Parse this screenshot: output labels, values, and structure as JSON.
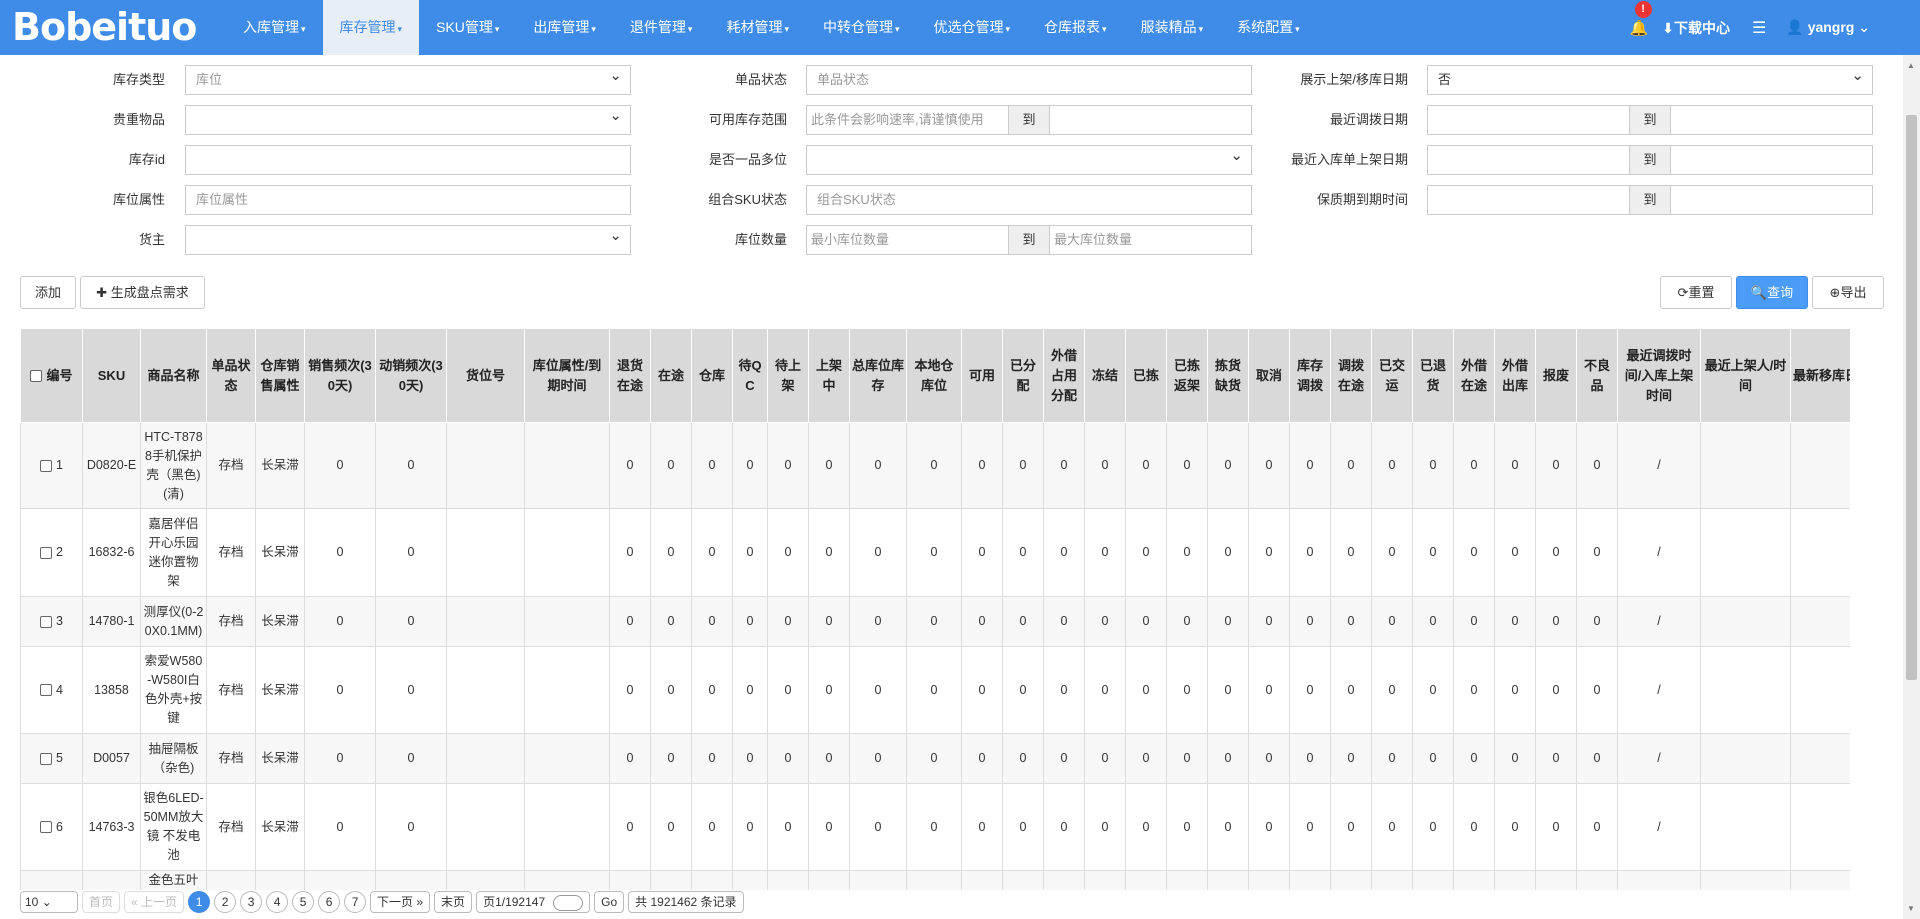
{
  "app": {
    "logo": "Bobeituo"
  },
  "nav": [
    {
      "label": "入库管理",
      "active": false
    },
    {
      "label": "库存管理",
      "active": true
    },
    {
      "label": "SKU管理",
      "active": false
    },
    {
      "label": "出库管理",
      "active": false
    },
    {
      "label": "退件管理",
      "active": false
    },
    {
      "label": "耗材管理",
      "active": false
    },
    {
      "label": "中转仓管理",
      "active": false
    },
    {
      "label": "优选仓管理",
      "active": false
    },
    {
      "label": "仓库报表",
      "active": false
    },
    {
      "label": "服装精品",
      "active": false
    },
    {
      "label": "系统配置",
      "active": false
    }
  ],
  "topright": {
    "badge": "!",
    "download": "下载中心",
    "user": "yangrg"
  },
  "filters": {
    "stock_type": {
      "label": "库存类型",
      "placeholder": "库位"
    },
    "valuables": {
      "label": "贵重物品",
      "value": ""
    },
    "stock_id": {
      "label": "库存id",
      "value": ""
    },
    "bin_attr": {
      "label": "库位属性",
      "placeholder": "库位属性"
    },
    "owner": {
      "label": "货主",
      "value": ""
    },
    "item_status": {
      "label": "单品状态",
      "placeholder": "单品状态"
    },
    "avail_range": {
      "label": "可用库存范围",
      "placeholder": "此条件会影响速率,请谨慎使用",
      "to": "到"
    },
    "one_item_multi": {
      "label": "是否一品多位",
      "value": ""
    },
    "combo_sku": {
      "label": "组合SKU状态",
      "placeholder": "组合SKU状态"
    },
    "bin_qty": {
      "label": "库位数量",
      "min_placeholder": "最小库位数量",
      "to": "到",
      "max_placeholder": "最大库位数量"
    },
    "show_date": {
      "label": "展示上架/移库日期",
      "value": "否"
    },
    "recent_transfer": {
      "label": "最近调拨日期",
      "to": "到"
    },
    "recent_inbound": {
      "label": "最近入库单上架日期",
      "to": "到"
    },
    "expiry": {
      "label": "保质期到期时间",
      "to": "到"
    }
  },
  "actions": {
    "add": "添加",
    "gen": "生成盘点需求",
    "reset": "重置",
    "query": "查询",
    "export": "导出"
  },
  "table": {
    "headers": [
      "编号",
      "SKU",
      "商品名称",
      "单品状态",
      "仓库销售属性",
      "销售频次(30天)",
      "动销频次(30天)",
      "货位号",
      "库位属性/到期时间",
      "退货在途",
      "在途",
      "仓库",
      "待QC",
      "待上架",
      "上架中",
      "总库位库存",
      "本地仓库位",
      "可用",
      "已分配",
      "外借占用分配",
      "冻结",
      "已拣",
      "已拣返架",
      "拣货缺货",
      "取消",
      "库存调拨",
      "调拨在途",
      "已交运",
      "已退货",
      "外借在途",
      "外借出库",
      "报废",
      "不良品",
      "最近调拨时间/入库上架时间",
      "最近上架人/时间",
      "最新移库日期"
    ],
    "rows": [
      {
        "no": "1",
        "sku": "D0820-E",
        "name": "HTC-T8788手机保护壳（黑色)(清)",
        "status": "存档",
        "attr": "长呆滞",
        "sale": "0",
        "move": "0",
        "recent": "/"
      },
      {
        "no": "2",
        "sku": "16832-6",
        "name": "嘉居伴侣开心乐园迷你置物架",
        "status": "存档",
        "attr": "长呆滞",
        "sale": "0",
        "move": "0",
        "recent": "/"
      },
      {
        "no": "3",
        "sku": "14780-1",
        "name": "测厚仪(0-20X0.1MM)",
        "status": "存档",
        "attr": "长呆滞",
        "sale": "0",
        "move": "0",
        "recent": "/"
      },
      {
        "no": "4",
        "sku": "13858",
        "name": "索爱W580-W580I白色外壳+按键",
        "status": "存档",
        "attr": "长呆滞",
        "sale": "0",
        "move": "0",
        "recent": "/"
      },
      {
        "no": "5",
        "sku": "D0057",
        "name": "抽屉隔板（杂色)",
        "status": "存档",
        "attr": "长呆滞",
        "sale": "0",
        "move": "0",
        "recent": "/"
      },
      {
        "no": "6",
        "sku": "14763-3",
        "name": "银色6LED-50MM放大镜 不发电池",
        "status": "存档",
        "attr": "长呆滞",
        "sale": "0",
        "move": "0",
        "recent": "/"
      }
    ],
    "zero": "0",
    "partial_row_name": "金色五叶"
  },
  "pager": {
    "size": "10",
    "first": "首页",
    "prev": "« 上一页",
    "pages": [
      "1",
      "2",
      "3",
      "4",
      "5",
      "6",
      "7"
    ],
    "next": "下一页 »",
    "last": "末页",
    "info": "页1/192147",
    "go": "Go",
    "total": "共 1921462 条记录"
  }
}
